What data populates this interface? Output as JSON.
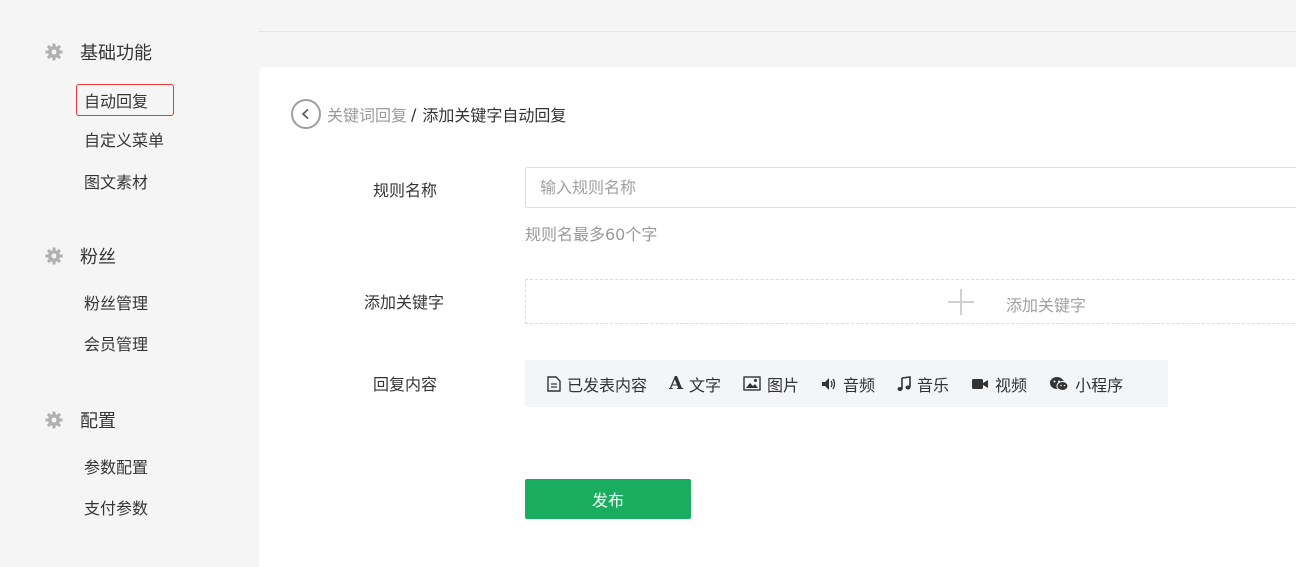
{
  "sidebar": {
    "groups": [
      {
        "title": "基础功能",
        "icon": "gear-icon",
        "items": [
          "自动回复",
          "自定义菜单",
          "图文素材"
        ]
      },
      {
        "title": "粉丝",
        "icon": "gear-icon",
        "items": [
          "粉丝管理",
          "会员管理"
        ]
      },
      {
        "title": "配置",
        "icon": "gear-icon",
        "items": [
          "参数配置",
          "支付参数"
        ]
      }
    ],
    "active_item": "自动回复"
  },
  "breadcrumb": {
    "parent": "关键词回复",
    "separator": "/",
    "current": "添加关键字自动回复"
  },
  "form": {
    "rule_name_label": "规则名称",
    "rule_name_placeholder": "输入规则名称",
    "rule_name_value": "",
    "rule_name_hint": "规则名最多60个字",
    "keyword_label": "添加关键字",
    "keyword_add_text": "添加关键字",
    "reply_label": "回复内容",
    "reply_types": [
      {
        "label": "已发表内容",
        "icon": "document-icon"
      },
      {
        "label": "文字",
        "icon": "text-icon"
      },
      {
        "label": "图片",
        "icon": "image-icon"
      },
      {
        "label": "音频",
        "icon": "speaker-icon"
      },
      {
        "label": "音乐",
        "icon": "music-note-icon"
      },
      {
        "label": "视频",
        "icon": "video-camera-icon"
      },
      {
        "label": "小程序",
        "icon": "mini-program-icon"
      }
    ],
    "publish_label": "发布"
  },
  "colors": {
    "primary": "#1aad5f",
    "active_border": "#e53935",
    "hint": "#9a9a9a"
  }
}
